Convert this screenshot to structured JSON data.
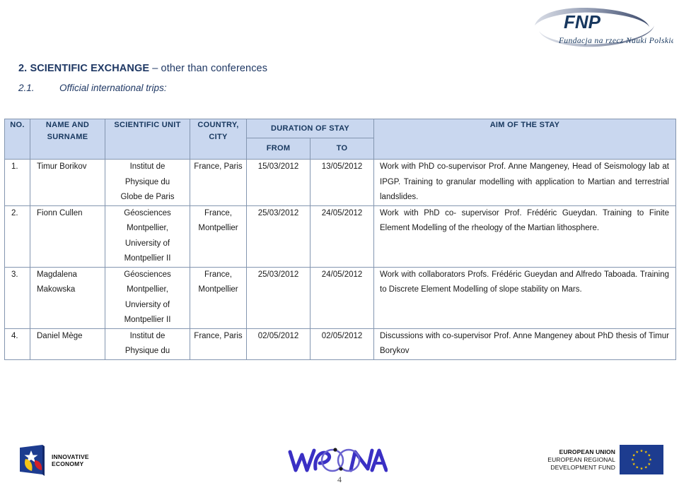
{
  "document": {
    "page_number": "4"
  },
  "brand_logo": {
    "name": "fnp-logo",
    "acronym": "FNP",
    "tagline": "Fundacja na rzecz Nauki Polskiej",
    "color": "#1f3864"
  },
  "headings": {
    "section_number": "2.",
    "section_title": "SCIENTIFIC EXCHANGE",
    "section_suffix": "– other than conferences",
    "subsection_number": "2.1.",
    "subsection_title": "Official international trips:",
    "color": "#1f3864"
  },
  "table": {
    "header_bg": "#c9d7ef",
    "header_text_color": "#17375e",
    "border_color": "#8496b0",
    "columns": {
      "no": "NO.",
      "name_line1": "NAME AND",
      "name_line2": "SURNAME",
      "scientific_unit": "SCIENTIFIC UNIT",
      "country_line1": "COUNTRY,",
      "country_line2": "CITY",
      "duration": "DURATION OF STAY",
      "from": "FROM",
      "to": "TO",
      "aim": "AIM OF THE STAY"
    },
    "rows": [
      {
        "no": "1.",
        "name": [
          "Timur Borikov"
        ],
        "unit": [
          "Institut de",
          "Physique du",
          "Globe de Paris"
        ],
        "country": [
          "France, Paris"
        ],
        "from": "15/03/2012",
        "to": "13/05/2012",
        "aim": "Work with PhD co-supervisor Prof. Anne Mangeney, Head of Seismology lab at IPGP. Training to granular modelling with application to Martian and terrestrial landslides."
      },
      {
        "no": "2.",
        "name": [
          "Fionn Cullen"
        ],
        "unit": [
          "Géosciences",
          "Montpellier,",
          "University of",
          "Montpellier II"
        ],
        "country": [
          "France,",
          "Montpellier"
        ],
        "from": "25/03/2012",
        "to": "24/05/2012",
        "aim": "Work with PhD co- supervisor Prof. Frédéric Gueydan. Training to Finite Element Modelling of the rheology of the Martian lithosphere."
      },
      {
        "no": "3.",
        "name": [
          "Magdalena",
          "Makowska"
        ],
        "unit": [
          "Géosciences",
          "Montpellier,",
          "Unviersity of",
          "Montpellier II"
        ],
        "country": [
          "France,",
          "Montpellier"
        ],
        "from": "25/03/2012",
        "to": "24/05/2012",
        "aim": "Work with collaborators Profs. Frédéric Gueydan and Alfredo Taboada. Training to Discrete Element Modelling of slope stability on Mars."
      },
      {
        "no": "4.",
        "name": [
          "Daniel Mège"
        ],
        "unit": [
          "Institut de",
          "Physique du"
        ],
        "country": [
          "France, Paris"
        ],
        "from": "02/05/2012",
        "to": "02/05/2012",
        "aim": "Discussions with co-supervisor Prof. Anne Mangeney about PhD thesis of Timur Borykov"
      }
    ]
  },
  "footer": {
    "innovative_economy": {
      "line1": "INNOVATIVE",
      "line2": "ECONOMY"
    },
    "wedna_logo": {
      "name": "wedna-logo",
      "color": "#3a2fc4"
    },
    "european_union": {
      "line1": "EUROPEAN UNION",
      "line2": "EUROPEAN REGIONAL",
      "line3": "DEVELOPMENT FUND",
      "flag_bg": "#1d3c8f",
      "star_color": "#ffcc00"
    }
  }
}
